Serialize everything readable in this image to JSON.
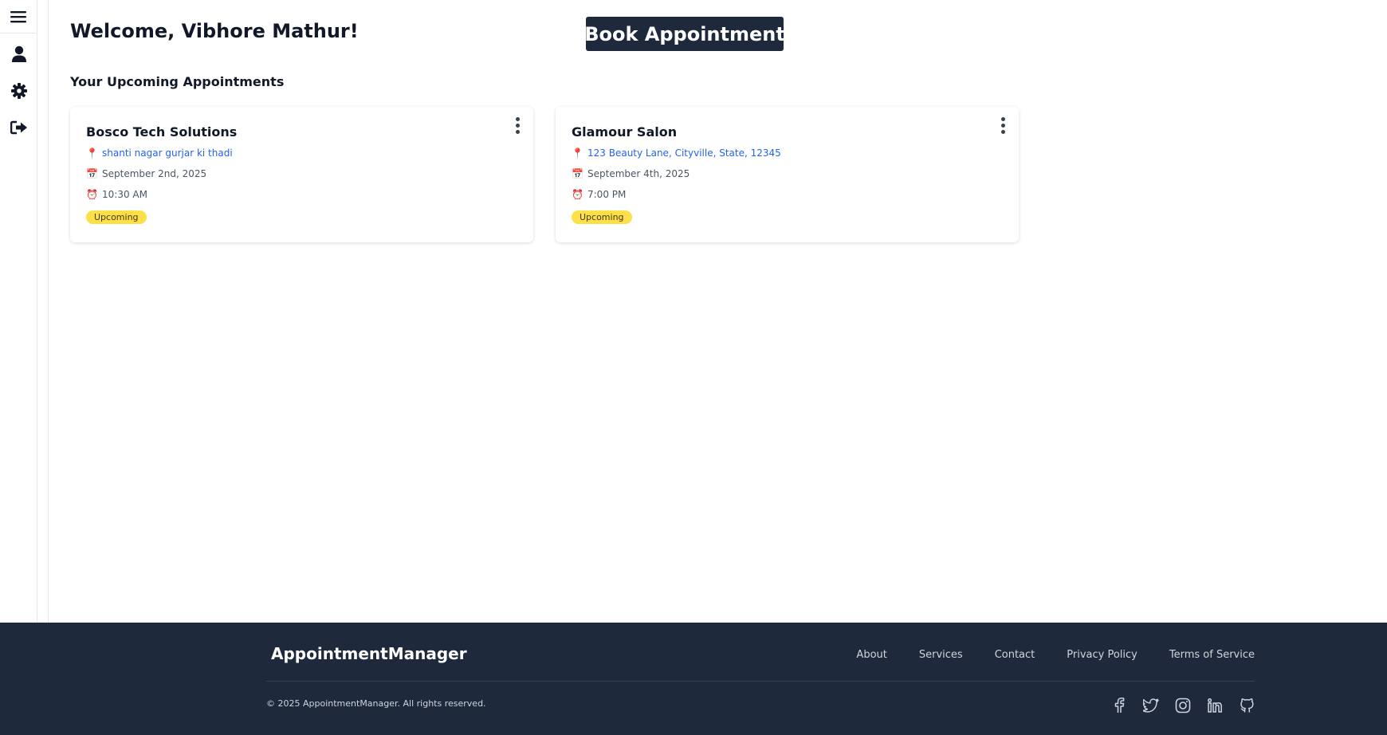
{
  "sidebar": {
    "icons": [
      "menu-icon",
      "user-icon",
      "gear-icon",
      "logout-icon"
    ]
  },
  "main": {
    "welcome": "Welcome, Vibhore Mathur!",
    "book_button": "Book Appointment",
    "section_title": "Your Upcoming Appointments",
    "appointments": [
      {
        "name": "Bosco Tech Solutions",
        "address_icon": "📍",
        "address": "shanti nagar gurjar ki thadi",
        "date_icon": "📅",
        "date": "September 2nd, 2025",
        "time_icon": "⏰",
        "time": "10:30 AM",
        "status": "Upcoming"
      },
      {
        "name": "Glamour Salon",
        "address_icon": "📍",
        "address": "123 Beauty Lane, Cityville, State, 12345",
        "date_icon": "📅",
        "date": "September 4th, 2025",
        "time_icon": "⏰",
        "time": "7:00 PM",
        "status": "Upcoming"
      }
    ]
  },
  "footer": {
    "brand": "AppointmentManager",
    "links": [
      "About",
      "Services",
      "Contact",
      "Privacy Policy",
      "Terms of Service"
    ],
    "copyright": "© 2025 AppointmentManager. All rights reserved.",
    "socials": [
      "facebook-icon",
      "twitter-icon",
      "instagram-icon",
      "linkedin-icon",
      "github-icon"
    ]
  },
  "colors": {
    "dark": "#1e293b",
    "link": "#2563eb",
    "badge": "#fde047"
  }
}
